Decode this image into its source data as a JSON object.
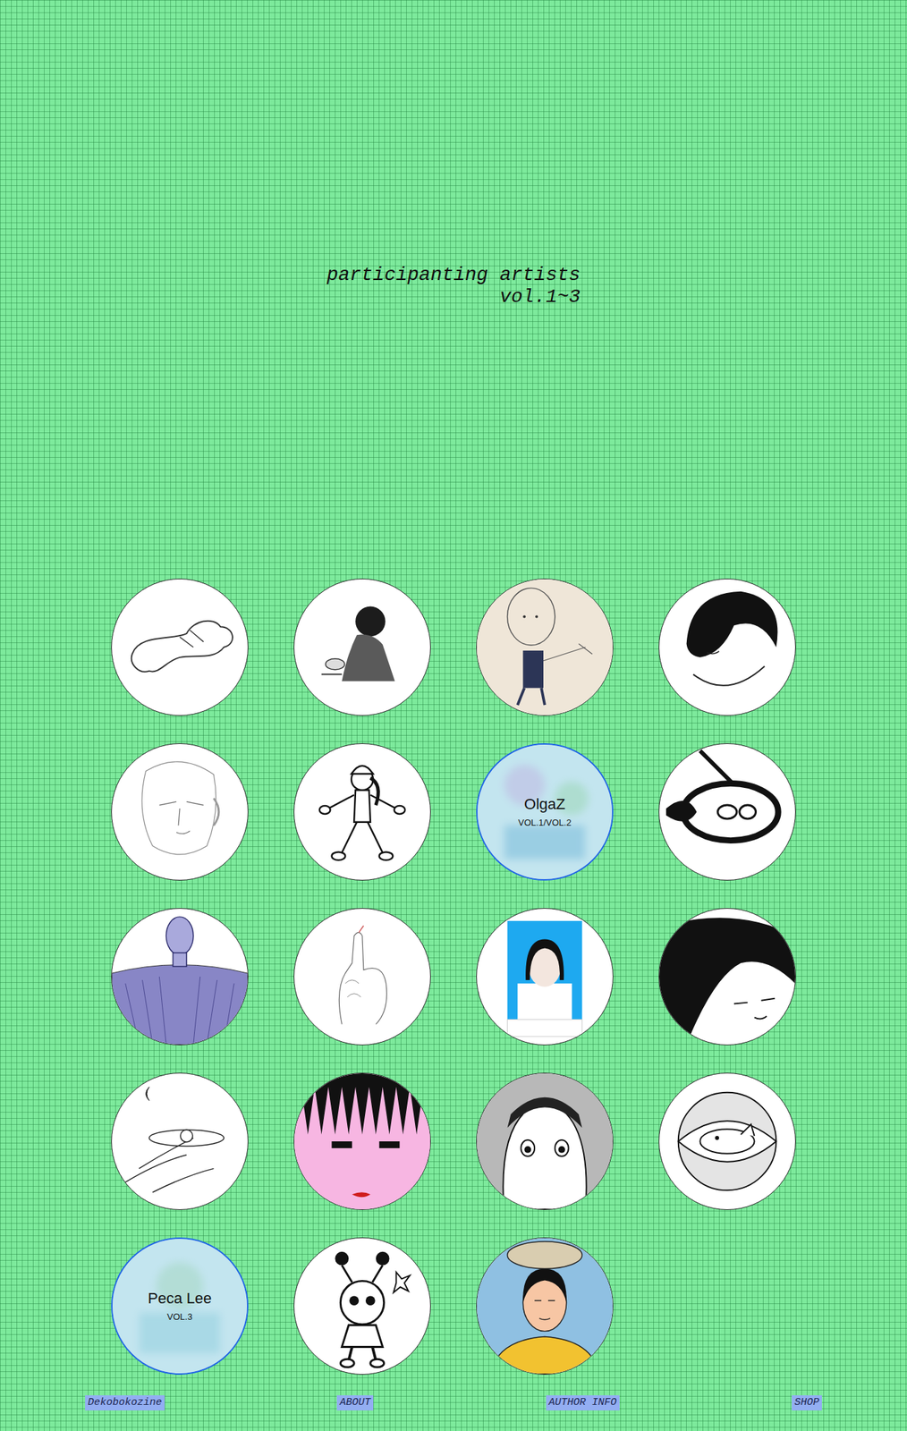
{
  "title": {
    "line1": "participanting artists",
    "line2": "vol.1~3"
  },
  "artists": [
    {
      "kind": "portrait",
      "hovered": false
    },
    {
      "kind": "portrait",
      "hovered": false
    },
    {
      "kind": "portrait",
      "hovered": false
    },
    {
      "kind": "portrait",
      "hovered": false
    },
    {
      "kind": "portrait",
      "hovered": false
    },
    {
      "kind": "portrait",
      "hovered": false
    },
    {
      "kind": "label",
      "hovered": true,
      "name": "OlgaZ",
      "volumes": "VOL.1/VOL.2"
    },
    {
      "kind": "portrait",
      "hovered": false
    },
    {
      "kind": "portrait",
      "hovered": false
    },
    {
      "kind": "portrait",
      "hovered": false
    },
    {
      "kind": "portrait",
      "hovered": false
    },
    {
      "kind": "portrait",
      "hovered": false
    },
    {
      "kind": "portrait",
      "hovered": false
    },
    {
      "kind": "portrait",
      "hovered": false
    },
    {
      "kind": "portrait",
      "hovered": false
    },
    {
      "kind": "portrait",
      "hovered": false
    },
    {
      "kind": "label",
      "hovered": true,
      "name": "Peca Lee",
      "volumes": "VOL.3"
    },
    {
      "kind": "portrait",
      "hovered": false
    },
    {
      "kind": "portrait",
      "hovered": false
    }
  ],
  "nav": [
    {
      "label": "Dekobokozine"
    },
    {
      "label": "ABOUT"
    },
    {
      "label": "AUTHOR INFO"
    },
    {
      "label": "SHOP"
    }
  ]
}
